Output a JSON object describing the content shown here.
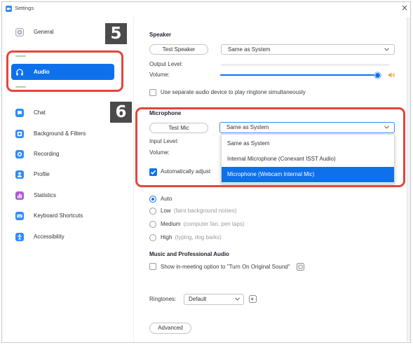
{
  "window": {
    "title": "Settings",
    "close_glyph": "×",
    "app_icon": "zoom-app-icon"
  },
  "colors": {
    "accent": "#0e71eb",
    "annotation": "#e2463c",
    "badge": "#4b4b4b"
  },
  "annotations": [
    {
      "label": "5"
    },
    {
      "label": "6"
    }
  ],
  "sidebar": {
    "items": [
      {
        "label": "General",
        "icon": "gear-icon",
        "selected": false
      },
      {
        "label": "Audio",
        "icon": "headphones-icon",
        "selected": true
      },
      {
        "label": "Chat",
        "icon": "chat-icon",
        "selected": false
      },
      {
        "label": "Background & Filters",
        "icon": "background-icon",
        "selected": false
      },
      {
        "label": "Recording",
        "icon": "recording-icon",
        "selected": false
      },
      {
        "label": "Profile",
        "icon": "profile-icon",
        "selected": false
      },
      {
        "label": "Statistics",
        "icon": "statistics-icon",
        "selected": false
      },
      {
        "label": "Keyboard Shortcuts",
        "icon": "keyboard-icon",
        "selected": false
      },
      {
        "label": "Accessibility",
        "icon": "accessibility-icon",
        "selected": false
      }
    ]
  },
  "speaker": {
    "heading": "Speaker",
    "test_button": "Test Speaker",
    "device": "Same as System",
    "output_level_label": "Output Level:",
    "volume_label": "Volume:",
    "volume_level": 0.97
  },
  "separate_ringtone_device": {
    "label": "Use separate audio device to play ringtone simultaneously",
    "checked": false
  },
  "microphone": {
    "heading": "Microphone",
    "test_button": "Test Mic",
    "device": "Same as System",
    "dropdown_open": true,
    "options": [
      "Same as System",
      "Internal Microphone (Conexant ISST Audio)",
      "Microphone (Webcam Internal Mic)"
    ],
    "highlighted_option": 2,
    "input_level_label": "Input Level:",
    "volume_label": "Volume:",
    "auto_adjust": {
      "label": "Automatically adjust",
      "checked": true
    }
  },
  "noise_suppression": {
    "options": [
      {
        "label": "Auto",
        "note": "",
        "selected": true
      },
      {
        "label": "Low",
        "note": "(faint background noises)",
        "selected": false
      },
      {
        "label": "Medium",
        "note": "(computer fan, pen taps)",
        "selected": false
      },
      {
        "label": "High",
        "note": "(typing, dog barks)",
        "selected": false
      }
    ]
  },
  "music_audio": {
    "heading": "Music and Professional Audio",
    "original_sound": {
      "label": "Show in-meeting option to \"Turn On Original Sound\"",
      "checked": false,
      "icon": "info-icon"
    }
  },
  "ringtones": {
    "label": "Ringtones:",
    "value": "Default",
    "preview_icon": "speaker-icon"
  },
  "advanced_button": "Advanced"
}
